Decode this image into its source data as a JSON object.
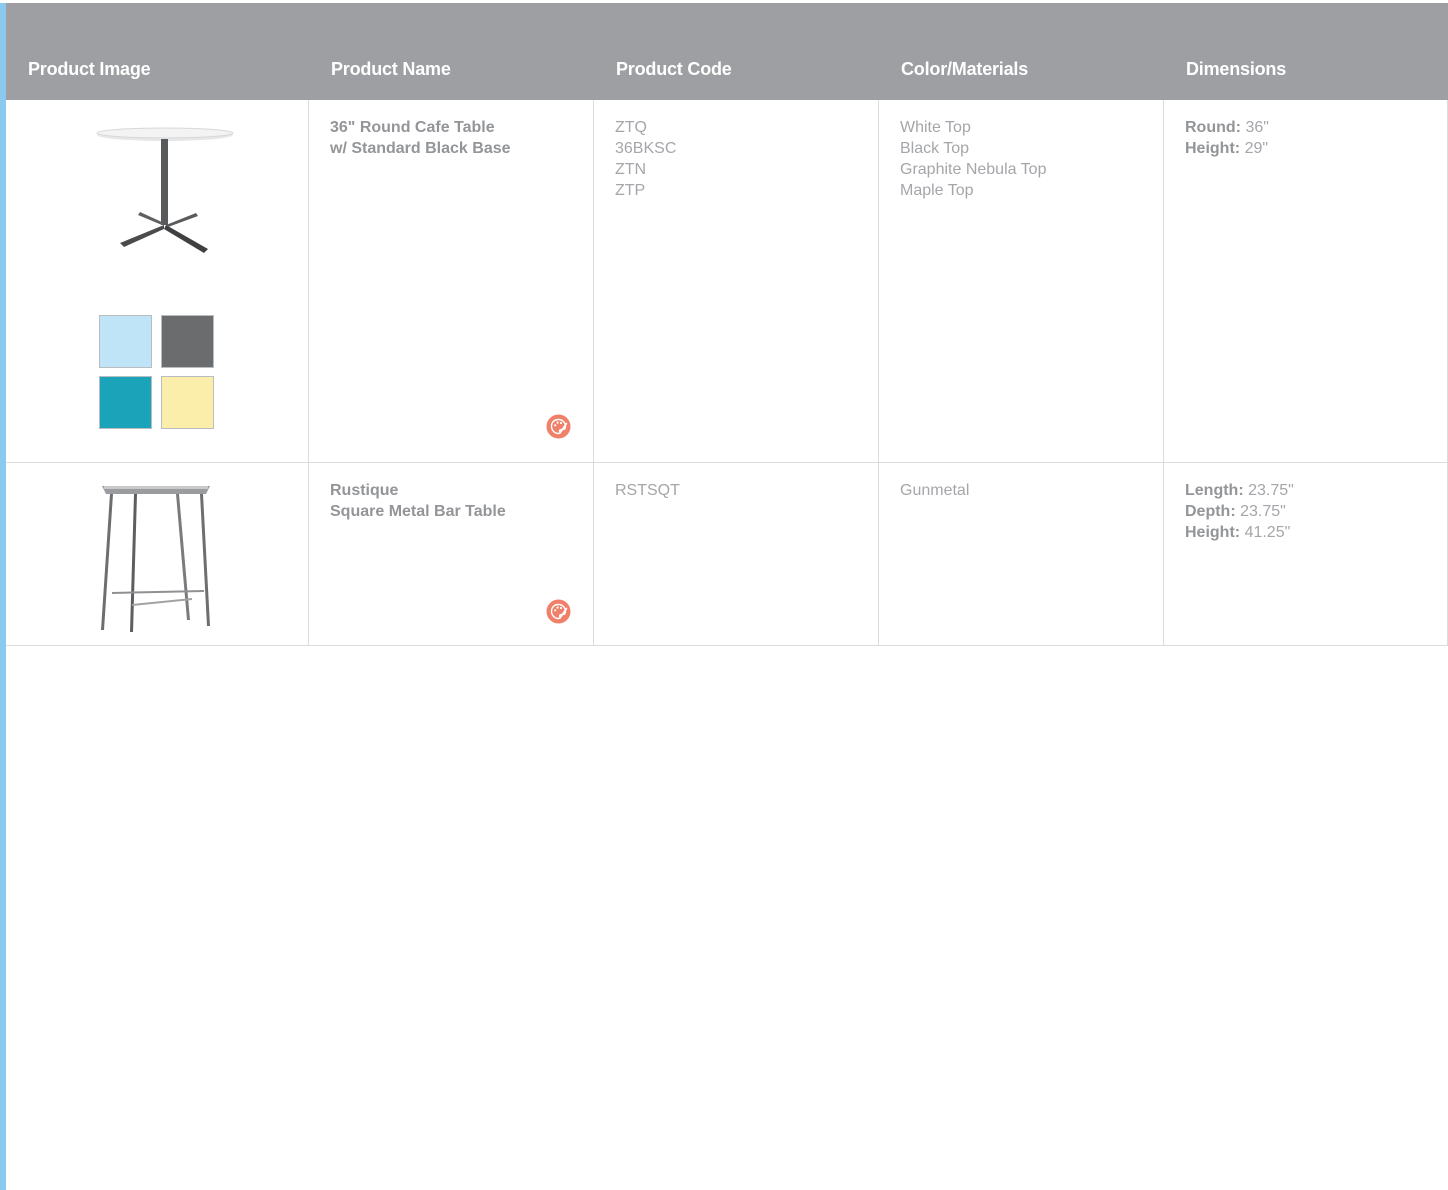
{
  "table": {
    "headers": [
      "Product Image",
      "Product Name",
      "Product Code",
      "Color/Materials",
      "Dimensions"
    ],
    "rows": [
      {
        "name_lines": [
          "36\" Round Cafe Table",
          "w/ Standard Black Base"
        ],
        "codes": [
          "ZTQ",
          "36BKSC",
          "ZTN",
          "ZTP"
        ],
        "colors": [
          "White Top",
          "Black Top",
          "Graphite Nebula Top",
          "Maple Top"
        ],
        "dimensions": [
          {
            "label": "Round:",
            "value": "36\""
          },
          {
            "label": "Height:",
            "value": "29\""
          }
        ],
        "swatch_colors": [
          "#bfe3f7",
          "#6b6c6e",
          "#1aa3b9",
          "#fbeeaa"
        ]
      },
      {
        "name_lines": [
          "Rustique",
          "Square Metal Bar Table"
        ],
        "codes": [
          "RSTSQT"
        ],
        "colors": [
          "Gunmetal"
        ],
        "dimensions": [
          {
            "label": "Length:",
            "value": "23.75\""
          },
          {
            "label": "Depth:",
            "value": "23.75\""
          },
          {
            "label": "Height:",
            "value": "41.25\""
          }
        ]
      }
    ]
  },
  "theme": {
    "header_bg": "#9d9fa2",
    "accent_stripe": "#8cc9ee",
    "palette_icon_color": "#f0806a"
  }
}
